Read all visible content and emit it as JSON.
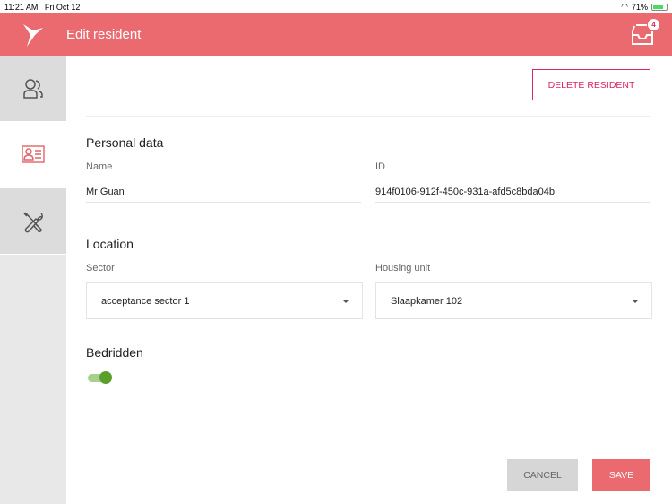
{
  "status_bar": {
    "time": "11:21 AM",
    "date": "Fri Oct 12",
    "battery": "71%"
  },
  "header": {
    "title": "Edit resident",
    "inbox_count": "4"
  },
  "sidebar": {
    "items": [
      {
        "name": "residents"
      },
      {
        "name": "resident-details",
        "active": true
      },
      {
        "name": "settings"
      }
    ]
  },
  "actions": {
    "delete_label": "DELETE RESIDENT",
    "cancel_label": "CANCEL",
    "save_label": "SAVE"
  },
  "personal": {
    "heading": "Personal data",
    "name_label": "Name",
    "name_value": "Mr Guan",
    "id_label": "ID",
    "id_value": "914f0106-912f-450c-931a-afd5c8bda04b"
  },
  "location": {
    "heading": "Location",
    "sector_label": "Sector",
    "sector_value": "acceptance sector 1",
    "unit_label": "Housing unit",
    "unit_value": "Slaapkamer 102"
  },
  "bedridden": {
    "heading": "Bedridden",
    "value": true
  },
  "colors": {
    "brand": "#ea6a6f",
    "accent": "#e0245e",
    "toggle": "#5c9e2a"
  }
}
